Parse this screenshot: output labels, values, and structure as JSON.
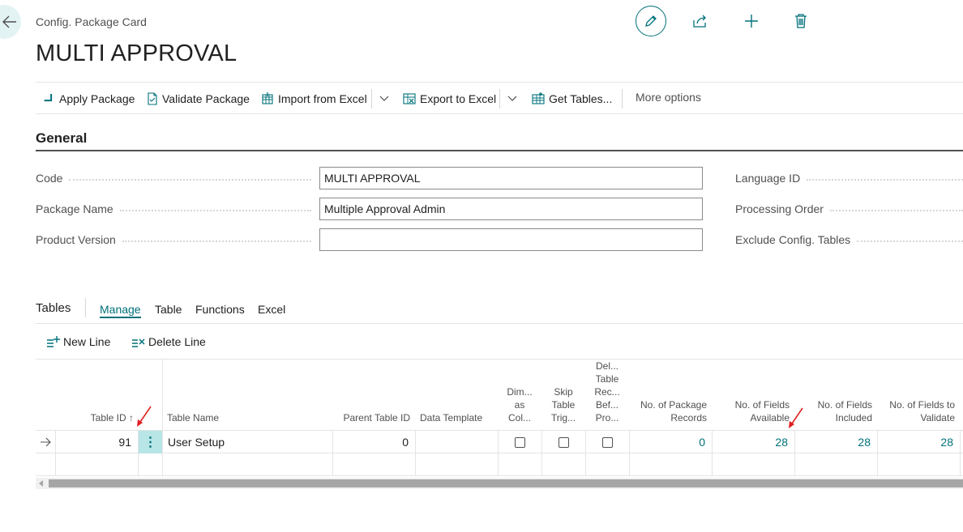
{
  "header": {
    "breadcrumb": "Config. Package Card",
    "title": "MULTI APPROVAL"
  },
  "actions": {
    "apply_package": "Apply Package",
    "validate_package": "Validate Package",
    "import_from_excel": "Import from Excel",
    "export_to_excel": "Export to Excel",
    "get_tables": "Get Tables...",
    "more_options": "More options"
  },
  "general": {
    "title": "General",
    "fields": {
      "code": {
        "label": "Code",
        "value": "MULTI APPROVAL"
      },
      "package_name": {
        "label": "Package Name",
        "value": "Multiple Approval Admin"
      },
      "product_version": {
        "label": "Product Version",
        "value": ""
      }
    },
    "right_fields": {
      "language_id": "Language ID",
      "processing_order": "Processing Order",
      "exclude_config_tables": "Exclude Config. Tables"
    }
  },
  "tables_part": {
    "title": "Tables",
    "tabs": [
      "Manage",
      "Table",
      "Functions",
      "Excel"
    ],
    "actions": {
      "new_line": "New Line",
      "delete_line": "Delete Line"
    },
    "columns": {
      "table_id": "Table ID ↑",
      "table_name": "Table Name",
      "parent_table_id": "Parent Table ID",
      "data_template": "Data Template",
      "dim_as_col": "Dim... as Col...",
      "skip_table_trig": "Skip Table Trig...",
      "del_table_rec": "Del... Table Rec... Bef... Pro...",
      "no_package_records": "No. of Package Records",
      "no_fields_available": "No. of Fields Available",
      "no_fields_included": "No. of Fields Included",
      "no_fields_to_validate": "No. of Fields to Validate"
    },
    "rows": [
      {
        "table_id": "91",
        "table_name": "User Setup",
        "parent_table_id": "0",
        "data_template": "",
        "dim_as_col": false,
        "skip_table_trig": false,
        "del_table_rec": false,
        "no_package_records": "0",
        "no_fields_available": "28",
        "no_fields_included": "28",
        "no_fields_to_validate": "28"
      }
    ]
  },
  "colors": {
    "accent": "#00717a",
    "selected_cell": "#b8e5e6",
    "annotation_arrow": "#e01e1e"
  }
}
